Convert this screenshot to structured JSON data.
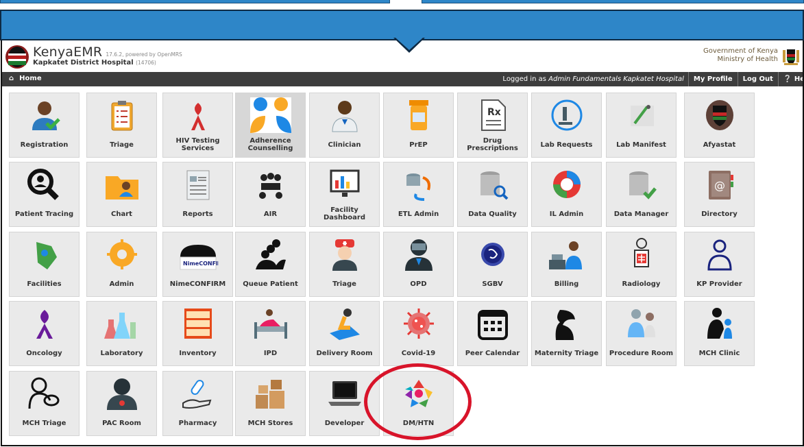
{
  "header": {
    "brand": "KenyaEMR",
    "version": "17.6.2, powered by OpenMRS",
    "facility": "Kapkatet District Hospital",
    "facility_code": "(14706)",
    "gov_line1": "Government of Kenya",
    "gov_line2": "Ministry of Health"
  },
  "navbar": {
    "home": "Home",
    "logged_prefix": "Logged in as",
    "logged_user": "Admin Fundamentals Kapkatet Hospital",
    "my_profile": "My Profile",
    "logout": "Log Out",
    "help": "He"
  },
  "colors": {
    "callout": "#2e86c8",
    "navbar": "#3d3d3d",
    "tile": "#eaeaea",
    "highlight": "#d8142a"
  },
  "apps": [
    {
      "label": "Registration",
      "icon": "registration-user-icon"
    },
    {
      "label": "Triage",
      "icon": "clipboard-checklist-icon"
    },
    {
      "label": "HIV Testing Services",
      "icon": "red-ribbon-icon"
    },
    {
      "label": "Adherence Counselling",
      "icon": "counselling-people-icon"
    },
    {
      "label": "Clinician",
      "icon": "doctor-icon"
    },
    {
      "label": "PrEP",
      "icon": "pill-bottle-icon"
    },
    {
      "label": "Drug Prescriptions",
      "icon": "prescription-rx-icon"
    },
    {
      "label": "Lab Requests",
      "icon": "microscope-icon"
    },
    {
      "label": "Lab Manifest",
      "icon": "lab-manifest-icon"
    },
    {
      "label": "Afyastat",
      "icon": "coat-of-arms-icon"
    },
    {
      "label": "Patient Tracing",
      "icon": "patient-search-icon"
    },
    {
      "label": "Chart",
      "icon": "folder-user-icon"
    },
    {
      "label": "Reports",
      "icon": "report-document-icon"
    },
    {
      "label": "AIR",
      "icon": "meeting-group-icon"
    },
    {
      "label": "Facility Dashboard",
      "icon": "dashboard-monitor-icon"
    },
    {
      "label": "ETL Admin",
      "icon": "database-sync-icon"
    },
    {
      "label": "Data Quality",
      "icon": "database-search-icon"
    },
    {
      "label": "IL Admin",
      "icon": "interop-circle-icon"
    },
    {
      "label": "Data Manager",
      "icon": "database-check-icon"
    },
    {
      "label": "Directory",
      "icon": "address-book-icon"
    },
    {
      "label": "Facilities",
      "icon": "map-pin-icon"
    },
    {
      "label": "Admin",
      "icon": "gear-icon"
    },
    {
      "label": "NimeCONFIRM",
      "icon": "nimeconfirm-logo-icon"
    },
    {
      "label": "Queue Patient",
      "icon": "queue-people-icon"
    },
    {
      "label": "Triage",
      "icon": "nurse-icon"
    },
    {
      "label": "OPD",
      "icon": "opd-doctor-icon"
    },
    {
      "label": "SGBV",
      "icon": "sgbv-badge-icon"
    },
    {
      "label": "Billing",
      "icon": "cashier-icon"
    },
    {
      "label": "Radiology",
      "icon": "xray-icon"
    },
    {
      "label": "KP Provider",
      "icon": "provider-icon"
    },
    {
      "label": "Oncology",
      "icon": "purple-ribbon-icon"
    },
    {
      "label": "Laboratory",
      "icon": "lab-flasks-icon"
    },
    {
      "label": "Inventory",
      "icon": "inventory-shelves-icon"
    },
    {
      "label": "IPD",
      "icon": "hospital-bed-icon"
    },
    {
      "label": "Delivery Room",
      "icon": "delivery-room-icon"
    },
    {
      "label": "Covid-19",
      "icon": "virus-icon"
    },
    {
      "label": "Peer Calendar",
      "icon": "calendar-icon"
    },
    {
      "label": "Maternity Triage",
      "icon": "maternity-icon"
    },
    {
      "label": "Procedure Room",
      "icon": "procedure-icon"
    },
    {
      "label": "MCH Clinic",
      "icon": "mother-child-icon"
    },
    {
      "label": "MCH Triage",
      "icon": "mother-baby-icon"
    },
    {
      "label": "PAC Room",
      "icon": "pac-doctor-icon"
    },
    {
      "label": "Pharmacy",
      "icon": "pill-hand-icon"
    },
    {
      "label": "MCH Stores",
      "icon": "boxes-icon"
    },
    {
      "label": "Developer",
      "icon": "laptop-icon"
    },
    {
      "label": "DM/HTN",
      "icon": "dm-htn-icon"
    }
  ]
}
